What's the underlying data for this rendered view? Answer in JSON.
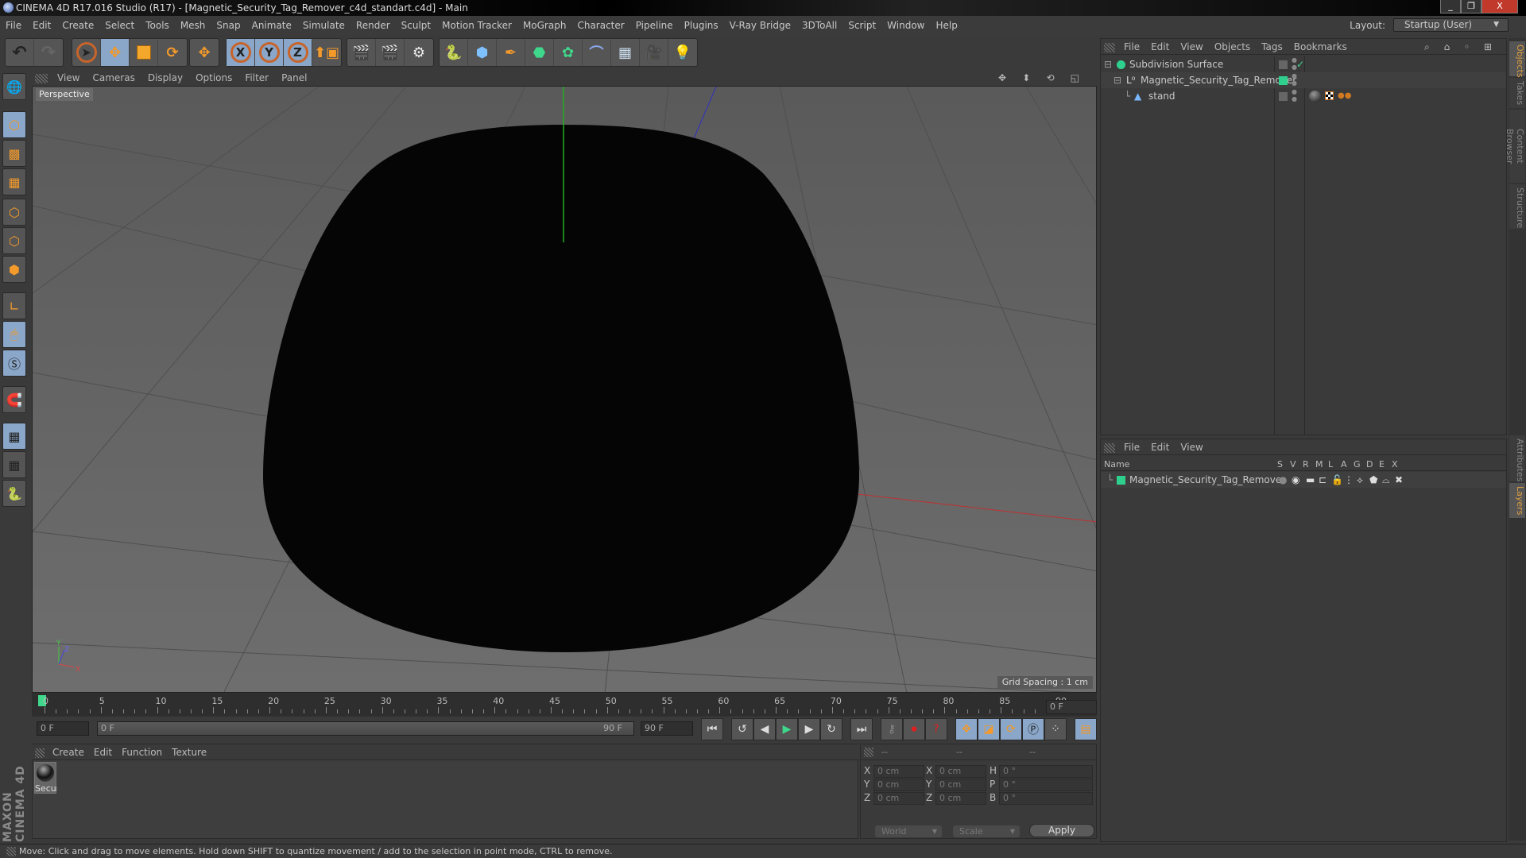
{
  "window": {
    "title": "CINEMA 4D R17.016 Studio (R17) - [Magnetic_Security_Tag_Remover_c4d_standart.c4d] - Main",
    "minimize": "_",
    "restore": "❐",
    "close": "X"
  },
  "menu": {
    "items": [
      "File",
      "Edit",
      "Create",
      "Select",
      "Tools",
      "Mesh",
      "Snap",
      "Animate",
      "Simulate",
      "Render",
      "Sculpt",
      "Motion Tracker",
      "MoGraph",
      "Character",
      "Pipeline",
      "Plugins",
      "V-Ray Bridge",
      "3DToAll",
      "Script",
      "Window",
      "Help"
    ],
    "layout_label": "Layout:",
    "layout_value": "Startup (User)"
  },
  "toolbar": {
    "undo": "↶",
    "redo": "↷",
    "tools": [
      "live-selection",
      "move",
      "scale",
      "rotate",
      "move-alt"
    ],
    "axes": [
      "X",
      "Y",
      "Z"
    ],
    "render": [
      "render-view",
      "render-picture-viewer",
      "render-settings"
    ],
    "objects": [
      "python",
      "cube",
      "pen",
      "subdivision",
      "cloner",
      "deformer",
      "floor",
      "camera",
      "light"
    ]
  },
  "viewport": {
    "menu": [
      "View",
      "Cameras",
      "Display",
      "Options",
      "Filter",
      "Panel"
    ],
    "label": "Perspective",
    "grid_spacing": "Grid Spacing : 1 cm",
    "axis_labels": {
      "x": "X",
      "y": "Y",
      "z": "Z"
    }
  },
  "timeline": {
    "ticks": [
      "0",
      "5",
      "10",
      "15",
      "20",
      "25",
      "30",
      "35",
      "40",
      "45",
      "50",
      "55",
      "60",
      "65",
      "70",
      "75",
      "80",
      "85",
      "90"
    ],
    "current_frame": "0 F",
    "start_field": "0 F",
    "range_start": "0 F",
    "range_end": "90 F",
    "end_field": "90 F"
  },
  "materials": {
    "menu": [
      "Create",
      "Edit",
      "Function",
      "Texture"
    ],
    "items": [
      {
        "name": "Secur"
      }
    ]
  },
  "brand": "MAXON CINEMA 4D",
  "coordinates": {
    "headers": [
      "--",
      "--",
      "--"
    ],
    "rows": [
      {
        "a": "X",
        "av": "0 cm",
        "b": "X",
        "bv": "0 cm",
        "c": "H",
        "cv": "0 °"
      },
      {
        "a": "Y",
        "av": "0 cm",
        "b": "Y",
        "bv": "0 cm",
        "c": "P",
        "cv": "0 °"
      },
      {
        "a": "Z",
        "av": "0 cm",
        "b": "Z",
        "bv": "0 cm",
        "c": "B",
        "cv": "0 °"
      }
    ],
    "space": "World",
    "mode": "Scale",
    "apply": "Apply"
  },
  "status": "Move: Click and drag to move elements. Hold down SHIFT to quantize movement / add to the selection in point mode, CTRL to remove.",
  "object_manager": {
    "menu": [
      "File",
      "Edit",
      "View",
      "Objects",
      "Tags",
      "Bookmarks"
    ],
    "objects": [
      {
        "name": "Subdivision Surface",
        "check": "✓"
      },
      {
        "name": "Magnetic_Security_Tag_Remover",
        "color": "#2fd08e"
      },
      {
        "name": "stand"
      }
    ]
  },
  "layer_manager": {
    "menu": [
      "File",
      "Edit",
      "View"
    ],
    "columns": [
      "Name",
      "S",
      "V",
      "R",
      "M",
      "L",
      "A",
      "G",
      "D",
      "E",
      "X"
    ],
    "layers": [
      {
        "name": "Magnetic_Security_Tag_Remover",
        "color": "#2fd08e"
      }
    ]
  },
  "side_tabs": {
    "top": [
      "Objects",
      "Takes",
      "Content Browser",
      "Structure"
    ],
    "bottom": [
      "Attributes",
      "Layers"
    ]
  }
}
